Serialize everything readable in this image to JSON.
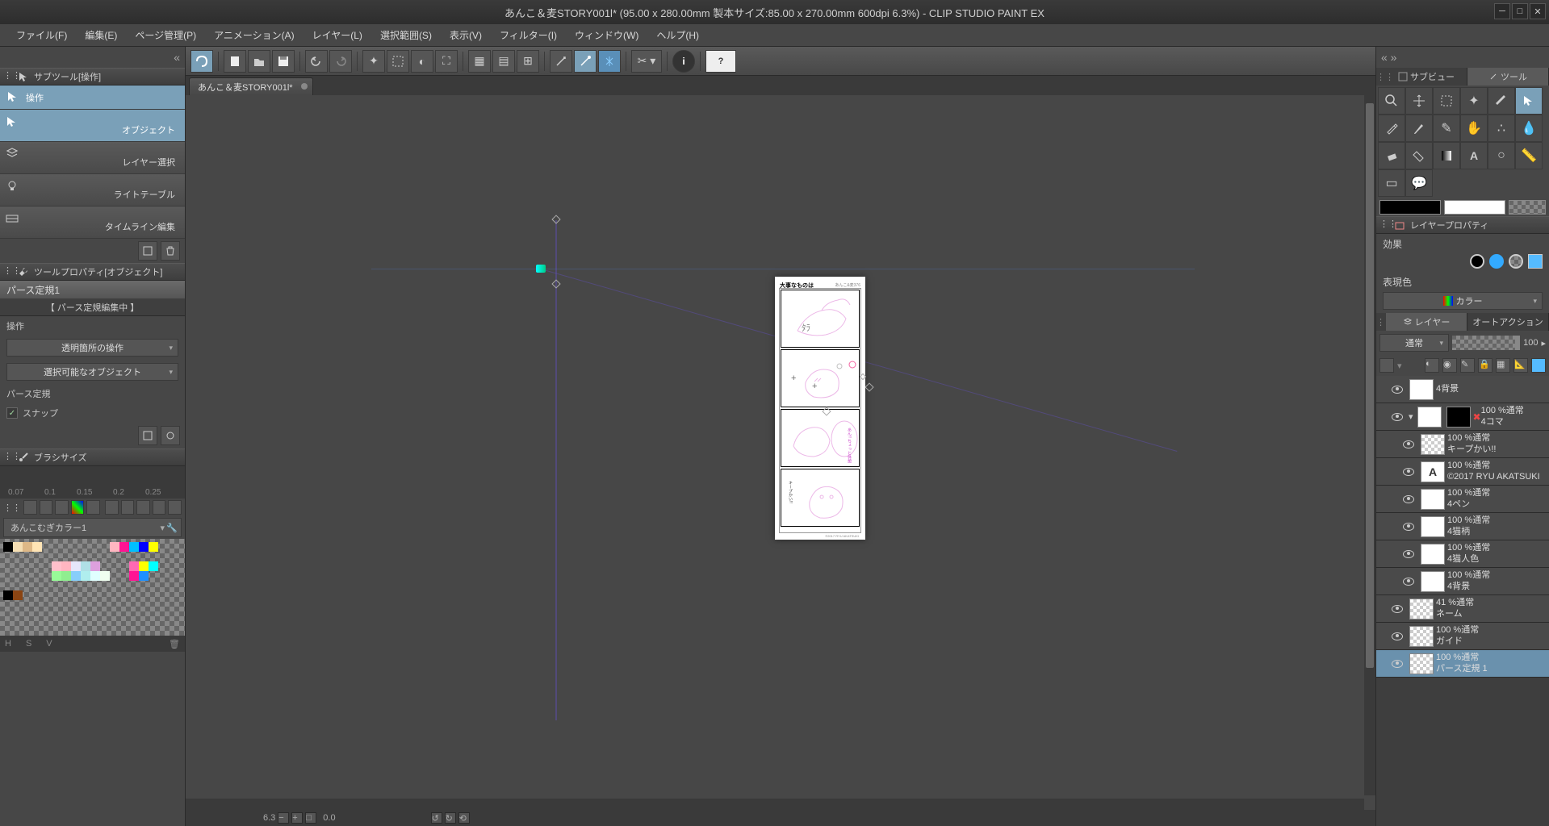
{
  "title": "あんこ＆麦STORY001l* (95.00 x 280.00mm 製本サイズ:85.00 x 270.00mm 600dpi 6.3%)  - CLIP STUDIO PAINT EX",
  "menu": [
    "ファイル(F)",
    "編集(E)",
    "ページ管理(P)",
    "アニメーション(A)",
    "レイヤー(L)",
    "選択範囲(S)",
    "表示(V)",
    "フィルター(I)",
    "ウィンドウ(W)",
    "ヘルプ(H)"
  ],
  "doc_tab": "あんこ＆麦STORY001l*",
  "left": {
    "subtool_header": "サブツール[操作]",
    "active_tool": "操作",
    "subtools": [
      "オブジェクト",
      "レイヤー選択",
      "ライトテーブル",
      "タイムライン編集"
    ],
    "tool_prop_header": "ツールプロパティ[オブジェクト]",
    "tp_title": "パース定規1",
    "tp_sub": "【 パース定規編集中 】",
    "tp_op_label": "操作",
    "tp_combo1": "透明箇所の操作",
    "tp_combo2": "選択可能なオブジェクト",
    "tp_pers_label": "パース定規",
    "tp_snap": "スナップ",
    "brush_header": "ブラシサイズ",
    "brush_ticks": [
      "0.07",
      "0.1",
      "0.15",
      "0.2",
      "0.25"
    ],
    "palette_name": "あんこむぎカラー1"
  },
  "right": {
    "tabs1": [
      "サブビュー",
      "ツール"
    ],
    "lp_header": "レイヤープロパティ",
    "lp_effect": "効果",
    "lp_color": "表現色",
    "lp_color_val": "カラー",
    "layer_tab": "レイヤー",
    "auto_action": "オートアクション",
    "blend_mode": "通常",
    "opacity": "100",
    "layers": [
      {
        "name": "4背景",
        "op": "",
        "indent": 1,
        "thumb": "white"
      },
      {
        "name": "4コマ",
        "op": "100 %通常",
        "indent": 1,
        "thumb": "white",
        "sel": false,
        "folder": true
      },
      {
        "name": "キープかい!!",
        "op": "100 %通常",
        "indent": 2,
        "thumb": "check"
      },
      {
        "name": "©2017 RYU AKATSUKI",
        "op": "100 %通常",
        "indent": 2,
        "thumb": "white",
        "text": true
      },
      {
        "name": "4ペン",
        "op": "100 %通常",
        "indent": 2,
        "thumb": "white"
      },
      {
        "name": "4猫柄",
        "op": "100 %通常",
        "indent": 2,
        "thumb": "white"
      },
      {
        "name": "4猫人色",
        "op": "100 %通常",
        "indent": 2,
        "thumb": "white"
      },
      {
        "name": "4背景",
        "op": "100 %通常",
        "indent": 2,
        "thumb": "white"
      },
      {
        "name": "ネーム",
        "op": "41 %通常",
        "indent": 1,
        "thumb": "check"
      },
      {
        "name": "ガイド",
        "op": "100 %通常",
        "indent": 1,
        "thumb": "check"
      },
      {
        "name": "パース定規 1",
        "op": "100 %通常",
        "indent": 1,
        "thumb": "check",
        "sel": true
      }
    ]
  },
  "status": {
    "zoom": "6.3",
    "rot": "0.0"
  },
  "page_title": "大事なものは",
  "page_series": "あんこ&麦376",
  "speech1": "あん!! ちょっと休憩",
  "speech2": "キープかい!!",
  "copyright": "©2017 RYU AKATSUKI"
}
